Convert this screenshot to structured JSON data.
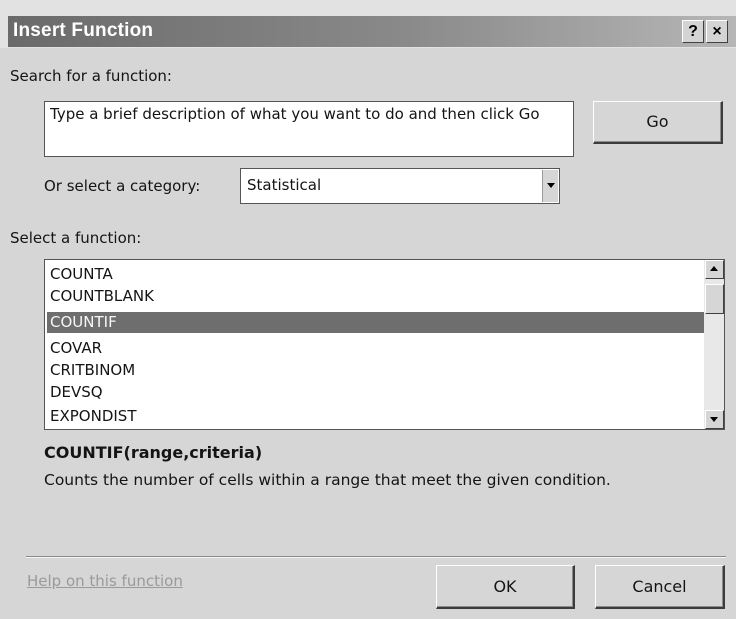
{
  "title": "Insert Function",
  "title_buttons": {
    "help": "?",
    "close": "×"
  },
  "search": {
    "label": "Search for a function:",
    "text": "Type a brief description of what you want to do and then click Go"
  },
  "go_button": "Go",
  "category": {
    "label": "Or select a category:",
    "value": "Statistical"
  },
  "function_list": {
    "label": "Select a function:",
    "items": [
      "COUNTA",
      "COUNTBLANK",
      "COUNTIF",
      "COVAR",
      "CRITBINOM",
      "DEVSQ",
      "EXPONDIST"
    ],
    "selected": "COUNTIF"
  },
  "syntax": "COUNTIF(range,criteria)",
  "description": "Counts the number of cells within a range that meet the given condition.",
  "help_link": "Help on this function",
  "ok_button": "OK",
  "cancel_button": "Cancel",
  "colors": {
    "selection": "#6e6e6e",
    "title_bar": "#7a7a7a",
    "link": "#9a9a9a"
  }
}
